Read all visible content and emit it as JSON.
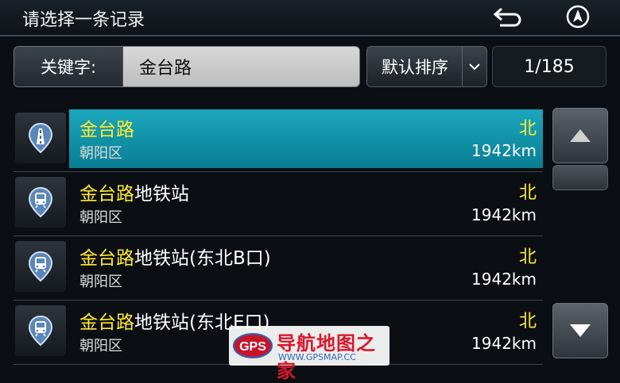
{
  "header": {
    "title": "请选择一条记录",
    "back_icon": "back-arrow-icon",
    "nav_icon": "navigation-arrow-icon"
  },
  "search": {
    "label": "关键字:",
    "value": "金台路"
  },
  "sort": {
    "label": "默认排序",
    "icon": "chevron-down-icon"
  },
  "pagination": {
    "count": "1/185"
  },
  "results": [
    {
      "keyword": "金台路",
      "suffix": "",
      "district": "朝阳区",
      "direction": "北",
      "distance": "1942km",
      "icon": "road-icon",
      "selected": true
    },
    {
      "keyword": "金台路",
      "suffix": "地铁站",
      "district": "朝阳区",
      "direction": "北",
      "distance": "1942km",
      "icon": "subway-icon",
      "selected": false
    },
    {
      "keyword": "金台路",
      "suffix": "地铁站(东北B口)",
      "district": "朝阳区",
      "direction": "北",
      "distance": "1942km",
      "icon": "subway-icon",
      "selected": false
    },
    {
      "keyword": "金台路",
      "suffix": "地铁站(东北E口)",
      "district": "朝阳区",
      "direction": "北",
      "distance": "1942km",
      "icon": "subway-icon",
      "selected": false
    }
  ],
  "scroll": {
    "up_icon": "triangle-up-icon",
    "down_icon": "triangle-down-icon"
  },
  "watermark": {
    "logo_text": "GPS",
    "title": "导航地图之家",
    "url": "WWW.GPSMAP.CC"
  },
  "colors": {
    "accent": "#12a0b8",
    "keyword": "#ffea2b"
  }
}
